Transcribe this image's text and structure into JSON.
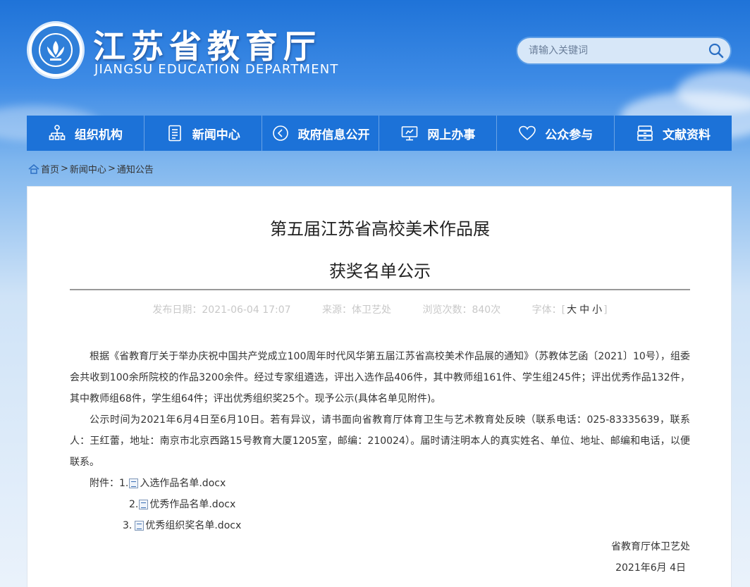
{
  "header": {
    "title_cn": "江苏省教育厅",
    "title_en": "JIANGSU EDUCATION DEPARTMENT"
  },
  "search": {
    "placeholder": "请输入关键词"
  },
  "nav": {
    "items": [
      {
        "label": "组织机构",
        "icon": "org-chart-icon"
      },
      {
        "label": "新闻中心",
        "icon": "document-icon"
      },
      {
        "label": "政府信息公开",
        "icon": "info-open-icon"
      },
      {
        "label": "网上办事",
        "icon": "monitor-icon"
      },
      {
        "label": "公众参与",
        "icon": "heart-icon"
      },
      {
        "label": "文献资料",
        "icon": "archive-icon"
      }
    ]
  },
  "breadcrumb": {
    "home": "首页",
    "sep": ">",
    "level1": "新闻中心",
    "level2": "通知公告"
  },
  "article": {
    "title_line1": "第五届江苏省高校美术作品展",
    "title_line2": "获奖名单公示",
    "publish_date": "发布日期：2021-06-04 17:07",
    "source": "来源：体卫艺处",
    "views": "浏览次数：840次",
    "font_label": "字体：[",
    "font_large": "大",
    "font_medium": "中",
    "font_small": "小",
    "font_close": "]",
    "para1": "根据《省教育厅关于举办庆祝中国共产党成立100周年时代风华第五届江苏省高校美术作品展的通知》（苏教体艺函〔2021〕10号），组委会共收到100余所院校的作品3200余件。经过专家组遴选，评出入选作品406件，其中教师组161件、学生组245件；评出优秀作品132件，其中教师组68件，学生组64件；评出优秀组织奖25个。现予公示(具体名单见附件)。",
    "para2": "公示时间为2021年6月4日至6月10日。若有异议，请书面向省教育厅体育卫生与艺术教育处反映（联系电话：025-83335639，联系人：王红蕾，地址：南京市北京西路15号教育大厦1205室，邮编：210024）。届时请注明本人的真实姓名、单位、地址、邮编和电话，以便联系。",
    "attach_label": "附件：",
    "attachments": [
      {
        "num": "1.",
        "name": "入选作品名单.docx"
      },
      {
        "num": "2.",
        "name": "优秀作品名单.docx"
      },
      {
        "num": "3.",
        "name": "优秀组织奖名单.docx"
      }
    ],
    "signer": "省教育厅体卫艺处",
    "sign_date": "2021年6月 4日"
  }
}
